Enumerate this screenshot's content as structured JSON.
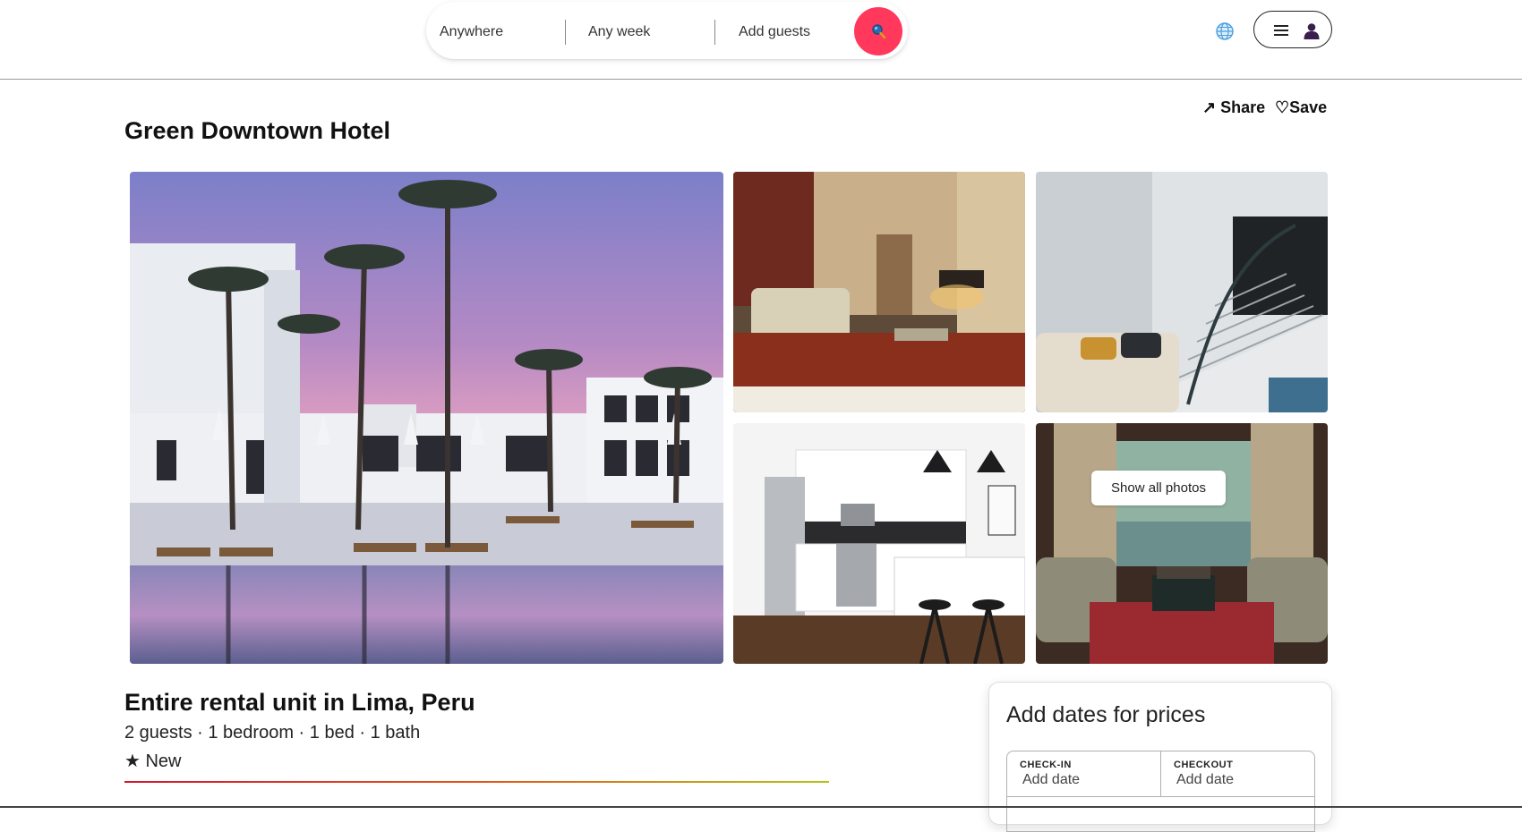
{
  "header": {
    "search": {
      "where": "Anywhere",
      "when": "Any week",
      "guests": "Add guests",
      "search_icon": "search-icon",
      "accent": "#ff385c"
    },
    "globe_icon": "globe-icon",
    "menu_icon": "hamburger-icon",
    "avatar_icon": "user-avatar-icon"
  },
  "listing": {
    "title": "Green Downtown Hotel",
    "share_label": "Share",
    "save_label": "Save",
    "share_icon": "arrow-up-right-icon",
    "save_icon": "heart-icon",
    "show_all_photos": "Show all photos",
    "subtitle": "Entire rental unit in Lima, Peru",
    "facts": "2 guests · 1 bedroom · 1 bed · 1 bath",
    "rating": "★ New"
  },
  "booking": {
    "heading": "Add dates for prices",
    "checkin_label": "CHECK-IN",
    "checkin_value": "Add date",
    "checkout_label": "CHECKOUT",
    "checkout_value": "Add date"
  }
}
